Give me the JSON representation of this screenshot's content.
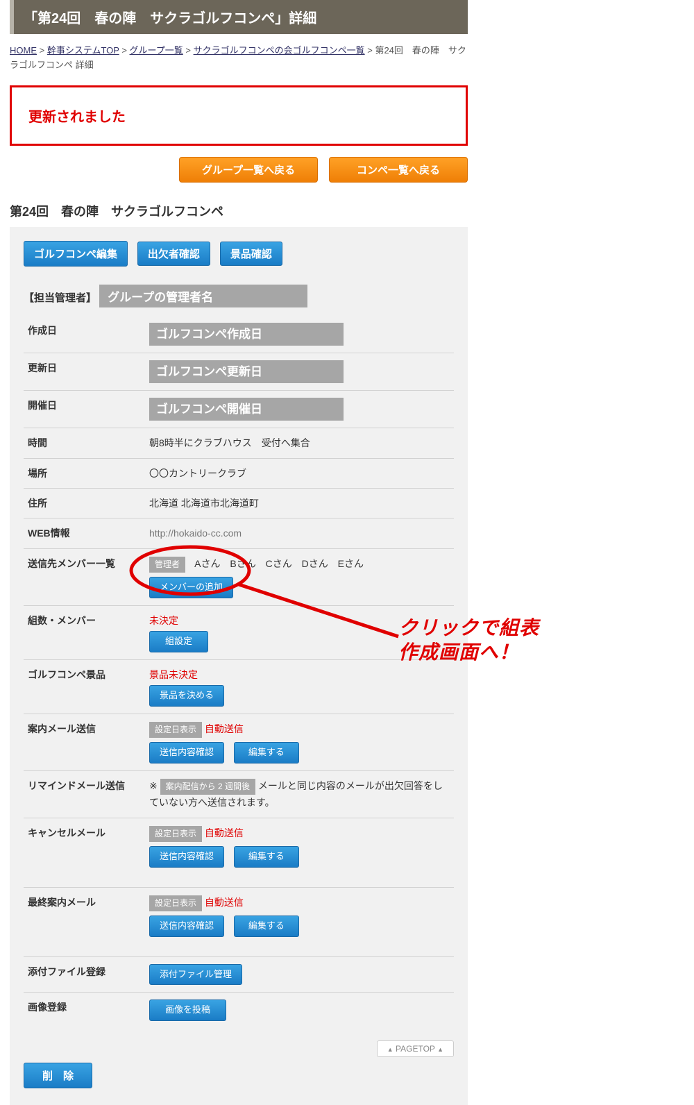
{
  "page_title": "「第24回　春の陣　サクラゴルフコンペ」詳細",
  "breadcrumb": {
    "links": [
      "HOME",
      "幹事システムTOP",
      "グループ一覧",
      "サクラゴルフコンペの会ゴルフコンペ一覧"
    ],
    "current": "第24回　春の陣　サクラゴルフコンペ 詳細",
    "sep": " > "
  },
  "flash": "更新されました",
  "nav_buttons": {
    "back_group": "グループ一覧へ戻る",
    "back_compo": "コンペ一覧へ戻る"
  },
  "section_heading": "第24回　春の陣　サクラゴルフコンペ",
  "top_actions": {
    "edit": "ゴルフコンペ編集",
    "attend": "出欠者確認",
    "prize": "景品確認"
  },
  "admin_row": {
    "label": "【担当管理者】",
    "value": "グループの管理者名"
  },
  "rows": {
    "created": {
      "key": "作成日",
      "value": "ゴルフコンペ作成日"
    },
    "updated": {
      "key": "更新日",
      "value": "ゴルフコンペ更新日"
    },
    "held": {
      "key": "開催日",
      "value": "ゴルフコンペ開催日"
    },
    "time": {
      "key": "時間",
      "value": "朝8時半にクラブハウス　受付へ集合"
    },
    "place": {
      "key": "場所",
      "value": "〇〇カントリークラブ"
    },
    "address": {
      "key": "住所",
      "value": "北海道 北海道市北海道町"
    },
    "web": {
      "key": "WEB情報",
      "value": "http://hokaido-cc.com"
    },
    "members": {
      "key": "送信先メンバー一覧",
      "admin_tag": "管理者",
      "list": [
        "Aさん",
        "Bさん",
        "Cさん",
        "Dさん",
        "Eさん"
      ],
      "add_btn": "メンバーの追加"
    },
    "groups": {
      "key": "組数・メンバー",
      "status": "未決定",
      "btn": "組設定"
    },
    "prizes": {
      "key": "ゴルフコンペ景品",
      "status": "景品未決定",
      "btn": "景品を決める"
    },
    "guide_mail": {
      "key": "案内メール送信",
      "date_tag": "設定日表示",
      "auto": "自動送信",
      "confirm_btn": "送信内容確認",
      "edit_btn": "編集する"
    },
    "remind_mail": {
      "key": "リマインドメール送信",
      "prefix": "※",
      "tag": "案内配信から 2 週間後",
      "text1": "メールと同じ内容のメールが出欠回答をしていない方へ送信されます。"
    },
    "cancel_mail": {
      "key": "キャンセルメール",
      "date_tag": "設定日表示",
      "auto": "自動送信",
      "confirm_btn": "送信内容確認",
      "edit_btn": "編集する"
    },
    "final_mail": {
      "key": "最終案内メール",
      "date_tag": "設定日表示",
      "auto": "自動送信",
      "confirm_btn": "送信内容確認",
      "edit_btn": "編集する"
    },
    "attach": {
      "key": "添付ファイル登録",
      "btn": "添付ファイル管理"
    },
    "image": {
      "key": "画像登録",
      "btn": "画像を投稿"
    }
  },
  "pagetop": "PAGETOP",
  "delete_btn": "削　除",
  "callout": "クリックで組表\n作成画面へ！"
}
